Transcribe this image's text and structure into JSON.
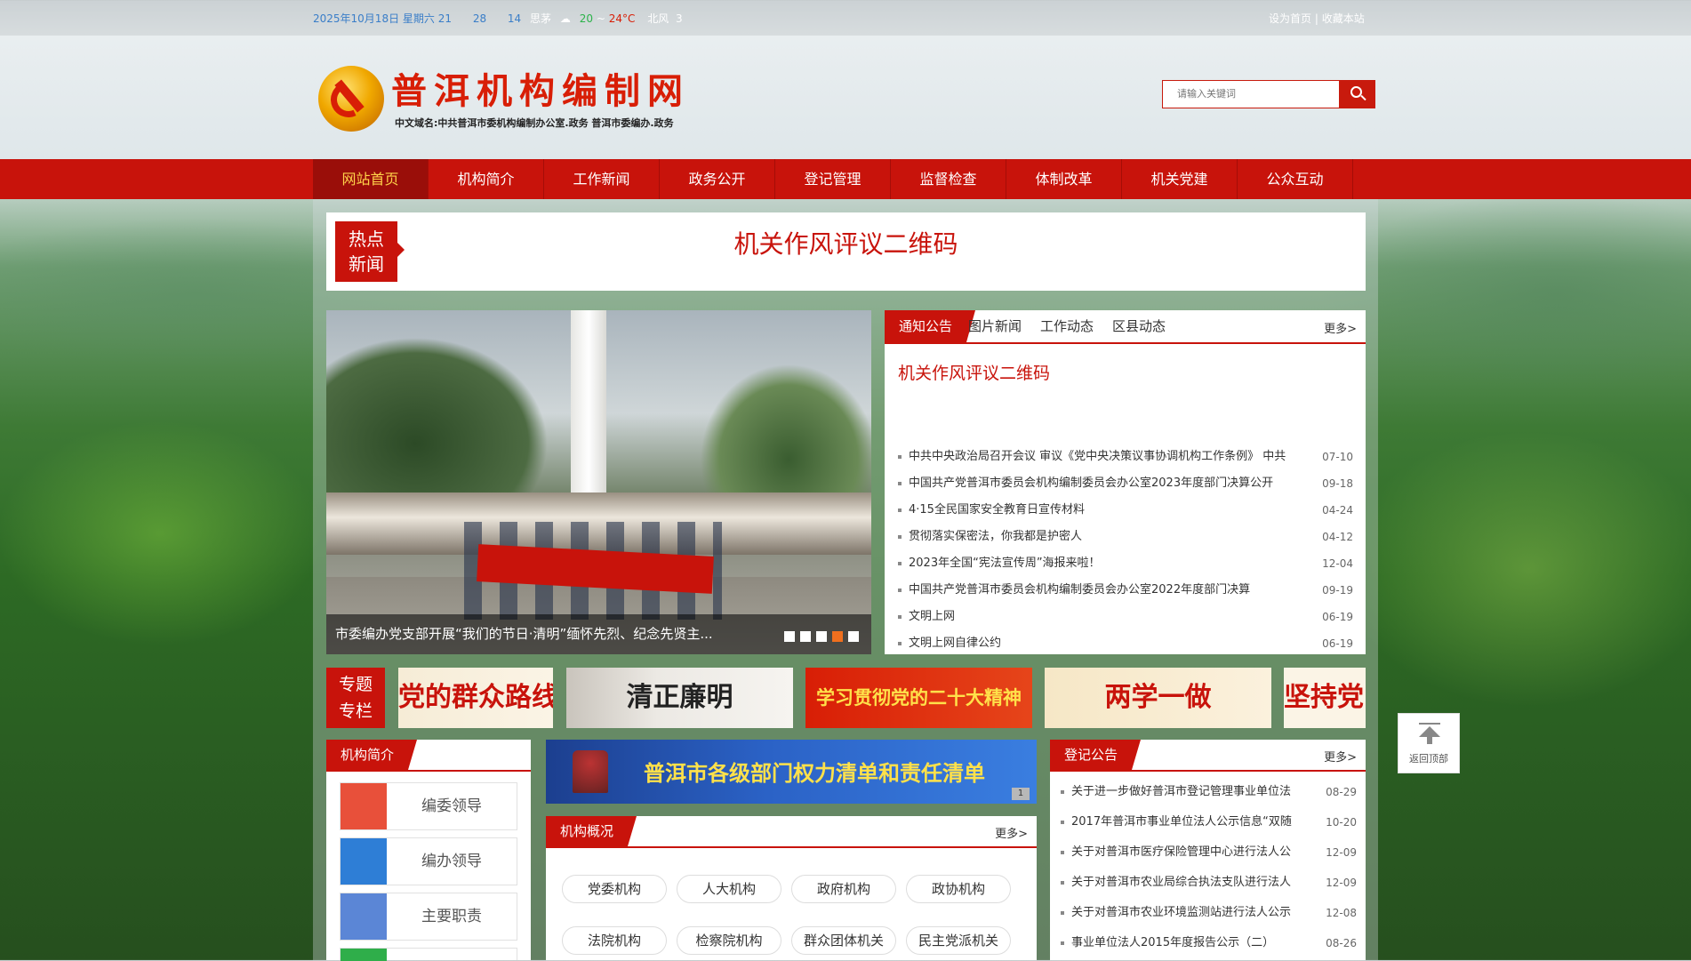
{
  "topbar": {
    "date": "2025年10月18日 星期六 21",
    "num1": "28",
    "num2": "14",
    "city": "思茅",
    "temp_low": "20",
    "temp_sep": "~",
    "temp_high": "24°C",
    "wind": "北风",
    "wind_level": "3",
    "set_home": "设为首页",
    "sep": "|",
    "bookmark": "收藏本站"
  },
  "header": {
    "title": "普洱机构编制网",
    "subtitle": "中文域名:中共普洱市委机构编制办公室.政务  普洱市委编办.政务",
    "search_placeholder": "请输入关键词"
  },
  "nav": [
    "网站首页",
    "机构简介",
    "工作新闻",
    "政务公开",
    "登记管理",
    "监督检查",
    "体制改革",
    "机关党建",
    "公众互动"
  ],
  "hot": {
    "badge_line1": "热点",
    "badge_line2": "新闻",
    "title": "机关作风评议二维码"
  },
  "slider": {
    "caption": "市委编办党支部开展“我们的节日·清明”缅怀先烈、纪念先贤主...",
    "active_dot": 3,
    "dot_count": 5
  },
  "notice": {
    "tabs": [
      "通知公告",
      "图片新闻",
      "工作动态",
      "区县动态"
    ],
    "more": "更多>",
    "headline": "机关作风评议二维码",
    "items": [
      {
        "title": "中共中央政治局召开会议 审议《党中央决策议事协调机构工作条例》 中共",
        "date": "07-10"
      },
      {
        "title": "中国共产党普洱市委员会机构编制委员会办公室2023年度部门决算公开",
        "date": "09-18"
      },
      {
        "title": "4·15全民国家安全教育日宣传材料",
        "date": "04-24"
      },
      {
        "title": "贯彻落实保密法，你我都是护密人",
        "date": "04-12"
      },
      {
        "title": "2023年全国“宪法宣传周”海报来啦！",
        "date": "12-04"
      },
      {
        "title": "中国共产党普洱市委员会机构编制委员会办公室2022年度部门决算",
        "date": "09-19"
      },
      {
        "title": "文明上网",
        "date": "06-19"
      },
      {
        "title": "文明上网自律公约",
        "date": "06-19"
      }
    ]
  },
  "special": {
    "badge_line1": "专题",
    "badge_line2": "专栏",
    "items": [
      "党的群众路线",
      "清正廉明",
      "学习贯彻党的二十大精神",
      "两学一做",
      "坚持党"
    ]
  },
  "jgjj": {
    "label": "机构简介",
    "items": [
      "编委领导",
      "编办领导",
      "主要职责",
      ""
    ]
  },
  "qzqd": {
    "text": "普洱市各级部门权力清单和责任清单",
    "page": "1"
  },
  "jggk": {
    "label": "机构概况",
    "more": "更多>",
    "pills": [
      "党委机构",
      "人大机构",
      "政府机构",
      "政协机构",
      "法院机构",
      "检察院机构",
      "群众团体机关",
      "民主党派机关"
    ]
  },
  "djgg": {
    "label": "登记公告",
    "more": "更多>",
    "items": [
      {
        "title": "关于进一步做好普洱市登记管理事业单位法",
        "date": "08-29"
      },
      {
        "title": "2017年普洱市事业单位法人公示信息“双随",
        "date": "10-20"
      },
      {
        "title": "关于对普洱市医疗保险管理中心进行法人公",
        "date": "12-09"
      },
      {
        "title": "关于对普洱市农业局综合执法支队进行法人",
        "date": "12-09"
      },
      {
        "title": "关于对普洱市农业环境监测站进行法人公示",
        "date": "12-08"
      },
      {
        "title": "事业单位法人2015年度报告公示（二）",
        "date": "08-26"
      }
    ]
  },
  "backtop": "返回顶部",
  "colors": {
    "primary_red": "#c8130b",
    "accent_orange": "#f06f1e",
    "nav_active_text": "#ffd34a"
  }
}
